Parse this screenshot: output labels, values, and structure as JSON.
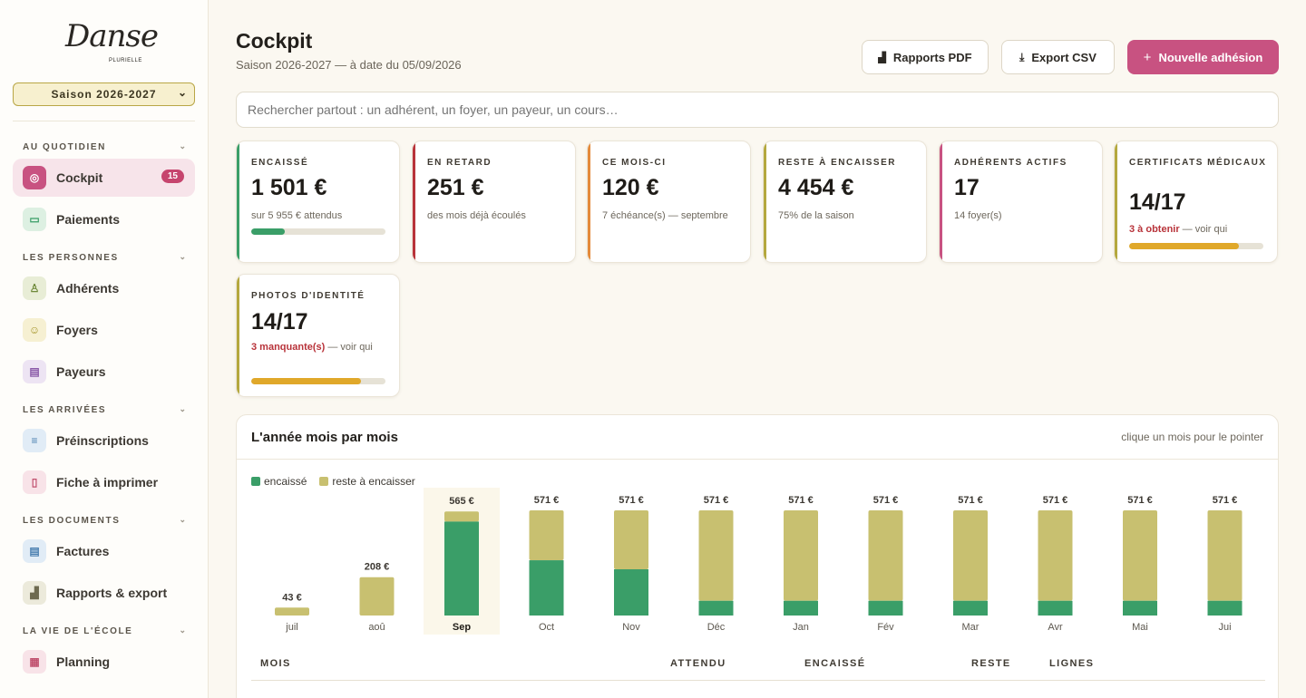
{
  "brand": {
    "logo_text": "Danse",
    "logo_sub": "PLURIELLE"
  },
  "season_select": {
    "value": "Saison 2026-2027"
  },
  "sidebar": {
    "sections": [
      {
        "title": "AU QUOTIDIEN",
        "items": [
          {
            "label": "Cockpit",
            "icon": "target-icon",
            "badge": "15",
            "active": true
          },
          {
            "label": "Paiements",
            "icon": "card-icon"
          }
        ]
      },
      {
        "title": "LES PERSONNES",
        "items": [
          {
            "label": "Adhérents",
            "icon": "person-icon"
          },
          {
            "label": "Foyers",
            "icon": "people-icon"
          },
          {
            "label": "Payeurs",
            "icon": "wallet-icon"
          }
        ]
      },
      {
        "title": "LES ARRIVÉES",
        "items": [
          {
            "label": "Préinscriptions",
            "icon": "list-icon"
          },
          {
            "label": "Fiche à imprimer",
            "icon": "clipboard-icon"
          }
        ]
      },
      {
        "title": "LES DOCUMENTS",
        "items": [
          {
            "label": "Factures",
            "icon": "document-icon"
          },
          {
            "label": "Rapports & export",
            "icon": "bar-chart-icon"
          }
        ]
      },
      {
        "title": "LA VIE DE L'ÉCOLE",
        "items": [
          {
            "label": "Planning",
            "icon": "calendar-icon"
          }
        ]
      }
    ]
  },
  "header": {
    "title": "Cockpit",
    "subtitle": "Saison 2026-2027 — à date du 05/09/2026",
    "btn_reports": "Rapports PDF",
    "btn_export": "Export CSV",
    "btn_new": "Nouvelle adhésion"
  },
  "search": {
    "placeholder": "Rechercher partout : un adhérent, un foyer, un payeur, un cours…"
  },
  "kpis": {
    "encaisse": {
      "label": "ENCAISSÉ",
      "value": "1 501 €",
      "sub": "sur 5 955 € attendus",
      "progress": 0.25
    },
    "retard": {
      "label": "EN RETARD",
      "value": "251 €",
      "sub": "des mois déjà écoulés"
    },
    "mois": {
      "label": "CE MOIS-CI",
      "value": "120 €",
      "sub": "7 échéance(s) — septembre"
    },
    "reste": {
      "label": "RESTE À ENCAISSER",
      "value": "4 454 €",
      "sub": "75% de la saison"
    },
    "actifs": {
      "label": "ADHÉRENTS ACTIFS",
      "value": "17",
      "sub": "14 foyer(s)"
    },
    "certificats": {
      "label": "CERTIFICATS MÉDICAUX",
      "value": "14/17",
      "warn": "3 à obtenir",
      "sub": " — voir qui",
      "progress": 0.82
    },
    "photos": {
      "label": "PHOTOS D'IDENTITÉ",
      "value": "14/17",
      "warn": "3 manquante(s)",
      "sub": " — voir qui",
      "progress": 0.82
    }
  },
  "panel": {
    "title": "L'année mois par mois",
    "hint": "clique un mois pour le pointer"
  },
  "colors": {
    "encaisse": "#3a9e68",
    "reste": "#c8c070",
    "accent": "#c85281"
  },
  "chart_data": {
    "type": "bar",
    "stacked": true,
    "categories": [
      "juil",
      "aoû",
      "Sep",
      "Oct",
      "Nov",
      "Déc",
      "Jan",
      "Fév",
      "Mar",
      "Avr",
      "Mai",
      "Jui"
    ],
    "totals_labels": [
      "43 €",
      "208 €",
      "565 €",
      "571 €",
      "571 €",
      "571 €",
      "571 €",
      "571 €",
      "571 €",
      "571 €",
      "571 €",
      "571 €"
    ],
    "series": [
      {
        "name": "encaissé",
        "values": [
          0,
          0,
          510,
          300,
          251,
          80,
          80,
          80,
          80,
          80,
          80,
          80
        ]
      },
      {
        "name": "reste à encaisser",
        "values": [
          43,
          208,
          55,
          271,
          320,
          491,
          491,
          491,
          491,
          491,
          491,
          491
        ]
      }
    ],
    "highlight": "Sep",
    "ylim": [
      0,
      571
    ]
  },
  "table": {
    "headers": [
      "MOIS",
      "ATTENDU",
      "ENCAISSÉ",
      "RESTE",
      "LIGNES"
    ]
  }
}
